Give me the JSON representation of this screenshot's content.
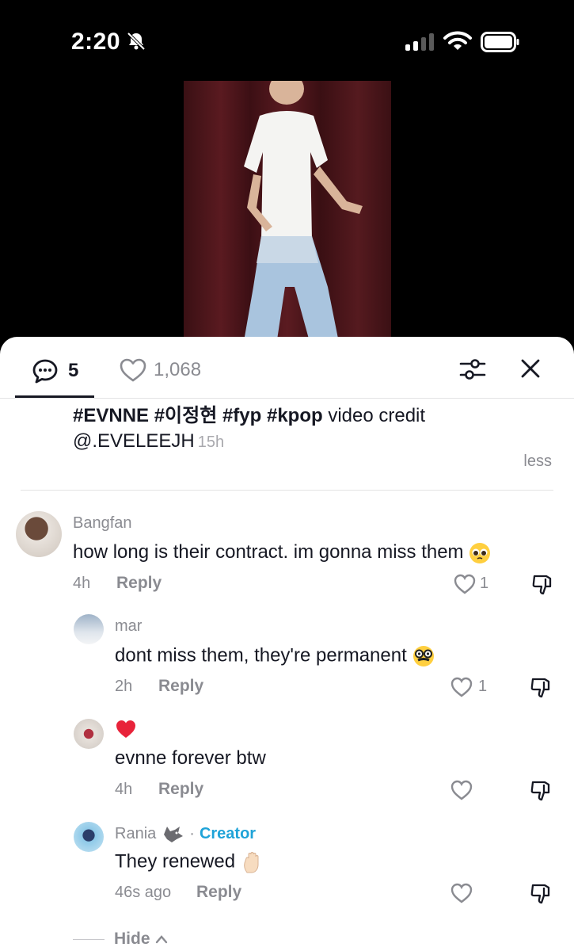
{
  "status_bar": {
    "time": "2:20"
  },
  "tabs": {
    "comments_count": "5",
    "likes_count": "1,068"
  },
  "caption": {
    "hashtags": "#EVNNE #이정현 #fyp #kpop",
    "text": " video credit",
    "mention": "@.EVELEEJH",
    "time": "15h",
    "less_label": "less"
  },
  "comments": [
    {
      "user": "Bangfan",
      "text": "how long is their contract. im gonna miss them",
      "time": "4h",
      "reply": "Reply",
      "likes": "1",
      "emoji": "pleading-face"
    },
    {
      "user": "mar",
      "text": "dont miss them, they're permanent",
      "time": "2h",
      "reply": "Reply",
      "likes": "1",
      "emoji": "disguised-face"
    },
    {
      "user": "",
      "text": "evnne forever btw",
      "time": "4h",
      "reply": "Reply",
      "likes": "",
      "user_emoji": "red-heart"
    },
    {
      "user": "Rania",
      "creator_label": "Creator",
      "text": "They renewed",
      "time": "46s ago",
      "reply": "Reply",
      "likes": "",
      "emoji": "raised-hand"
    }
  ],
  "hide_label": "Hide",
  "colors": {
    "creator": "#1fa3d8",
    "text": "#161823",
    "muted": "#8a8b91",
    "heart": "#e8233a"
  }
}
